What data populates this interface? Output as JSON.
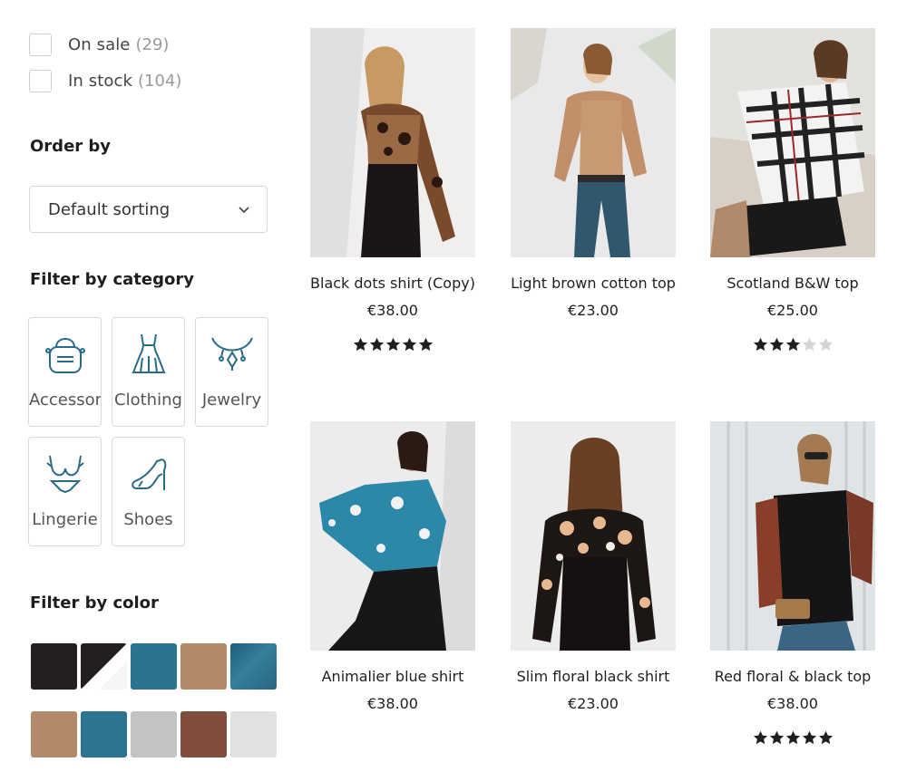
{
  "filters": {
    "on_sale": {
      "label": "On sale",
      "count": "29"
    },
    "in_stock": {
      "label": "In stock",
      "count": "104"
    }
  },
  "order": {
    "title": "Order by",
    "selected": "Default sorting"
  },
  "category": {
    "title": "Filter by category",
    "items": [
      {
        "label": "Accessori",
        "icon": "bag-icon"
      },
      {
        "label": "Clothing",
        "icon": "dress-icon"
      },
      {
        "label": "Jewelry",
        "icon": "necklace-icon"
      },
      {
        "label": "Lingerie",
        "icon": "bra-icon"
      },
      {
        "label": "Shoes",
        "icon": "high-heel-icon"
      }
    ]
  },
  "color": {
    "title": "Filter by color",
    "swatches": [
      "#231f20",
      "black-white-split",
      "#2b7490",
      "#b38a69",
      "#2f6f8a",
      "#b38a69",
      "#2d7490",
      "#c3c3c3",
      "#814d3c",
      "#e1e1e1"
    ]
  },
  "products": [
    {
      "title": "Black dots shirt (Copy)",
      "price": "€38.00",
      "rating": 5
    },
    {
      "title": "Light brown cotton top",
      "price": "€23.00",
      "rating": null
    },
    {
      "title": "Scotland B&W top",
      "price": "€25.00",
      "rating": 3
    },
    {
      "title": "Animalier blue shirt",
      "price": "€38.00",
      "rating": null
    },
    {
      "title": "Slim floral black shirt",
      "price": "€23.00",
      "rating": null
    },
    {
      "title": "Red floral & black top",
      "price": "€38.00",
      "rating": 5
    }
  ],
  "colors": {
    "border": "#d9d9d9",
    "icon": "#2a6a86",
    "star_filled": "#1f1f1f",
    "star_empty": "#d5d5d5"
  }
}
